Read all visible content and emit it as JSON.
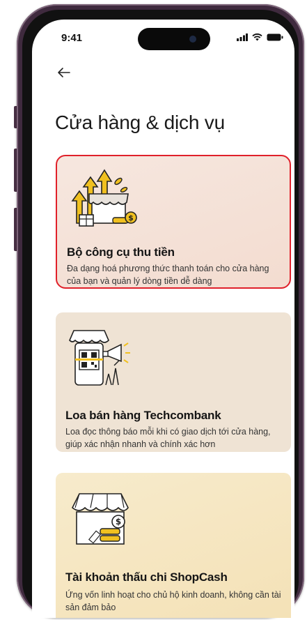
{
  "status": {
    "time": "9:41"
  },
  "page": {
    "title": "Cửa hàng & dịch vụ"
  },
  "cards": [
    {
      "title": "Bộ công cụ thu tiền",
      "description": "Đa dạng hoá phương thức thanh toán cho cửa hàng của bạn và quản lý dòng tiền dễ dàng",
      "icon": "store-growth-coins-icon",
      "selected": true
    },
    {
      "title": "Loa bán hàng Techcombank",
      "description": "Loa đọc thông báo mỗi khi có giao dịch tới cửa hàng, giúp xác nhận nhanh và chính xác hơn",
      "icon": "qr-speaker-icon",
      "selected": false
    },
    {
      "title": "Tài khoản thấu chi ShopCash",
      "description": "Ứng vốn linh hoạt cho chủ hộ kinh doanh, không cần tài sản đảm bảo",
      "icon": "shop-cash-icon",
      "selected": false
    }
  ],
  "colors": {
    "frame": "#3f2a3e",
    "highlight": "#e0202a",
    "accent_gold": "#f0c020"
  }
}
